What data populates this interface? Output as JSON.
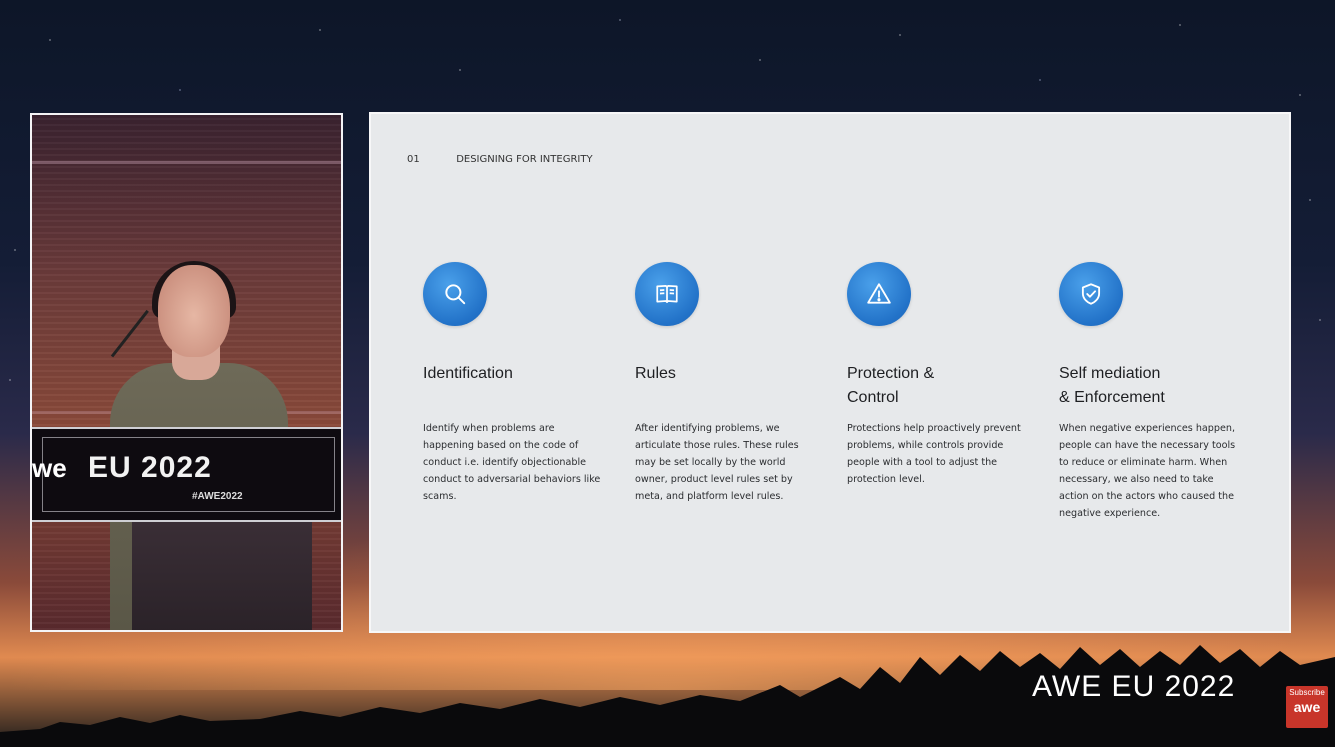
{
  "slide": {
    "section_number": "01",
    "section_title": "DESIGNING FOR INTEGRITY",
    "columns": [
      {
        "icon": "search-icon",
        "title": "Identification",
        "body": "Identify when problems are happening based on the code of conduct i.e. identify objectionable conduct to adversarial behaviors like scams."
      },
      {
        "icon": "book-icon",
        "title": "Rules",
        "body": "After identifying problems, we articulate those rules. These rules may be set locally by the world owner, product level rules set by meta, and platform level rules."
      },
      {
        "icon": "warning-icon",
        "title": "Protection &\nControl",
        "body": "Protections help proactively prevent problems, while controls provide people with a tool to adjust the protection level."
      },
      {
        "icon": "shield-check-icon",
        "title": "Self mediation\n& Enforcement",
        "body": "When negative experiences happen, people can have the necessary tools to reduce or eliminate harm. When necessary, we also need to take action on the actors who caused the negative experience."
      }
    ]
  },
  "video": {
    "podium_title": "EU 2022",
    "podium_hashtag": "#AWE2022",
    "podium_logo_fragment": "we"
  },
  "brand": {
    "event_name": "AWE EU 2022"
  },
  "subscribe": {
    "label": "Subscribe",
    "logo_text": "awe"
  },
  "colors": {
    "icon_blue": "#2272c8",
    "slide_bg": "#e7e9eb",
    "subscribe_red": "#c8352a"
  }
}
